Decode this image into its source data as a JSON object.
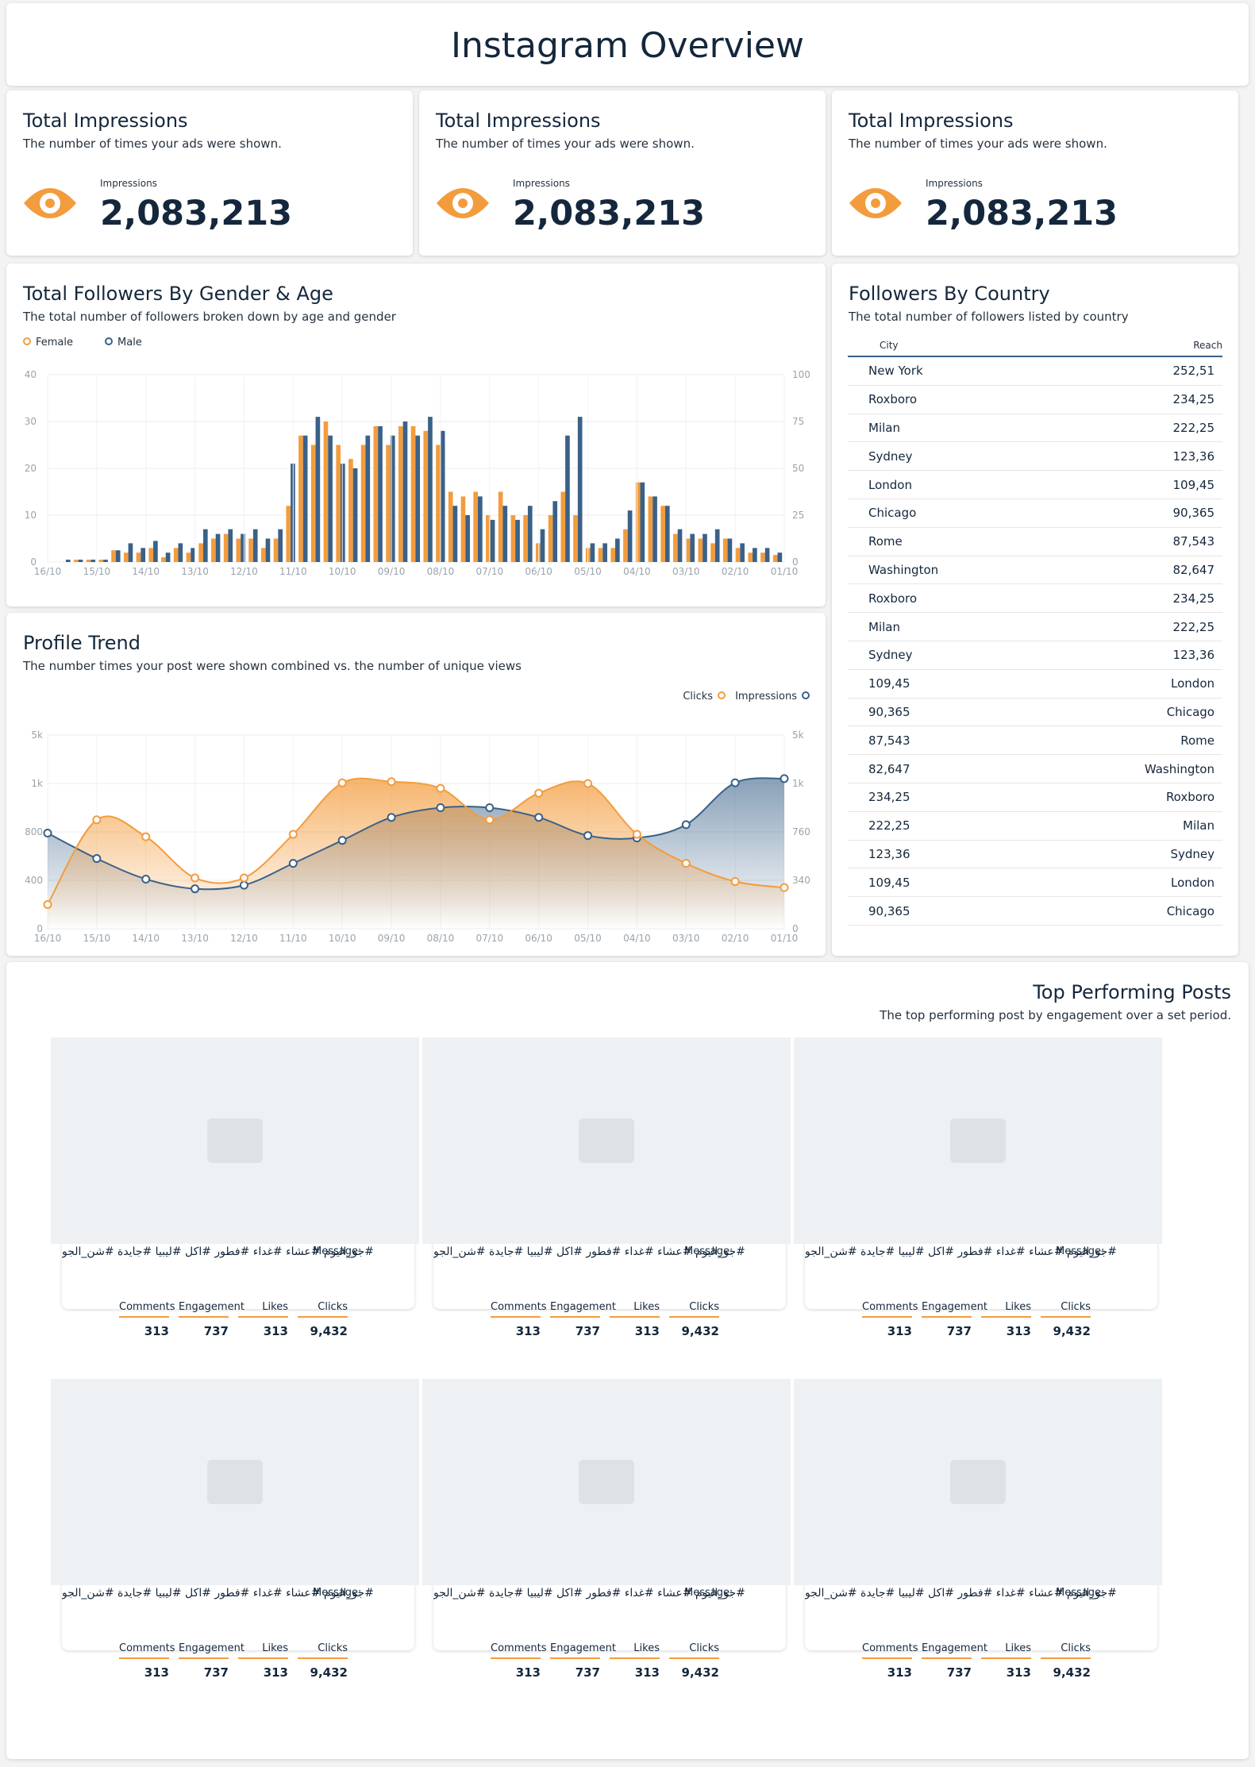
{
  "page": {
    "title": "Instagram Overview"
  },
  "kpis": [
    {
      "title": "Total Impressions",
      "subtitle": "The number of times your ads were shown.",
      "label": "Impressions",
      "value": "2,083,213",
      "icon": "eye-icon"
    },
    {
      "title": "Total Impressions",
      "subtitle": "The number of times your ads were shown.",
      "label": "Impressions",
      "value": "2,083,213",
      "icon": "eye-icon"
    },
    {
      "title": "Total Impressions",
      "subtitle": "The number of times your ads were shown.",
      "label": "Impressions",
      "value": "2,083,213",
      "icon": "eye-icon"
    }
  ],
  "gender_age": {
    "title": "Total Followers By Gender & Age",
    "subtitle": "The total number of followers broken down by age and gender",
    "legend": [
      "Female",
      "Male"
    ]
  },
  "profile_trend": {
    "title": "Profile Trend",
    "subtitle": "The number times your post were shown combined vs. the number of unique views",
    "legend": [
      "Clicks",
      "Impressions"
    ]
  },
  "country": {
    "title": "Followers By Country",
    "subtitle": "The total number of followers listed by country",
    "columns": [
      "City",
      "Reach"
    ],
    "rows": [
      [
        "New York",
        "252,51"
      ],
      [
        "Roxboro",
        "234,25"
      ],
      [
        "Milan",
        "222,25"
      ],
      [
        "Sydney",
        "123,36"
      ],
      [
        "London",
        "109,45"
      ],
      [
        "Chicago",
        "90,365"
      ],
      [
        "Rome",
        "87,543"
      ],
      [
        "Washington",
        "82,647"
      ],
      [
        "Roxboro",
        "234,25"
      ],
      [
        "Milan",
        "222,25"
      ],
      [
        "Sydney",
        "123,36"
      ],
      [
        "109,45",
        "London"
      ],
      [
        "90,365",
        "Chicago"
      ],
      [
        "87,543",
        "Rome"
      ],
      [
        "82,647",
        "Washington"
      ],
      [
        "234,25",
        "Roxboro"
      ],
      [
        "222,25",
        "Milan"
      ],
      [
        "123,36",
        "Sydney"
      ],
      [
        "109,45",
        "London"
      ],
      [
        "90,365",
        "Chicago"
      ]
    ]
  },
  "posts": {
    "title": "Top Performing Posts",
    "subtitle": "The top performing post by engagement over a set period.",
    "message_label": "Message:",
    "message_text": "#جو_اليوم #عشاء #غداء #فطور #اكل #ليبيا #جايدة #شن_الجو",
    "stat_labels": [
      "Comments",
      "Engagement",
      "Likes",
      "Clicks"
    ],
    "stat_values": [
      "313",
      "737",
      "313",
      "9,432"
    ]
  },
  "chart_data": [
    {
      "type": "bar",
      "categories": [
        "16/10",
        "15/10",
        "14/10",
        "13/10",
        "12/10",
        "11/10",
        "10/10",
        "09/10",
        "08/10",
        "07/10",
        "06/10",
        "05/10",
        "04/10",
        "03/10",
        "02/10",
        "01/10"
      ],
      "ylim": [
        0,
        40
      ],
      "y2lim": [
        0,
        100
      ],
      "yticks": [
        0,
        10,
        20,
        30,
        40
      ],
      "y2ticks": [
        0,
        25,
        50,
        75,
        100
      ],
      "series": [
        {
          "name": "Female",
          "values": [
            0,
            0,
            0.5,
            0.5,
            0.5,
            2.5,
            2,
            2,
            3,
            1,
            3,
            2,
            4,
            5,
            6,
            5,
            5,
            3,
            5,
            12,
            27,
            25,
            30,
            25,
            22,
            25,
            29,
            25,
            29,
            29,
            28,
            25,
            15,
            14,
            15,
            10,
            15,
            10,
            10,
            4,
            10,
            15,
            10,
            3,
            3,
            3,
            7,
            17,
            14,
            12,
            6,
            5,
            5,
            4,
            5,
            3,
            2,
            2,
            1.5
          ],
          "index_note": ""
        },
        {
          "name": "Male",
          "values": [
            0,
            0.5,
            0.5,
            0.5,
            0.5,
            2.5,
            4,
            3,
            4.5,
            2,
            4,
            3,
            7,
            6,
            7,
            6,
            7,
            5,
            7,
            21,
            27,
            31,
            27,
            21,
            20,
            27,
            29,
            27,
            30,
            27,
            31,
            28,
            12,
            10,
            14,
            9,
            12,
            9,
            12,
            7,
            13,
            27,
            31,
            4,
            4,
            5,
            11,
            17,
            14,
            12,
            7,
            6,
            6,
            7,
            5,
            4,
            3,
            3,
            2
          ]
        }
      ]
    },
    {
      "type": "line",
      "categories": [
        "16/10",
        "15/10",
        "14/10",
        "13/10",
        "12/10",
        "11/10",
        "10/10",
        "09/10",
        "08/10",
        "07/10",
        "06/10",
        "05/10",
        "04/10",
        "03/10",
        "02/10",
        "01/10"
      ],
      "yticks": [
        "0",
        "400",
        "800",
        "1k",
        "5k"
      ],
      "y2ticks": [
        "0",
        "340",
        "760",
        "1k",
        "5k"
      ],
      "series": [
        {
          "name": "Clicks",
          "values": [
            200,
            850,
            760,
            420,
            420,
            780,
            1050,
            1150,
            980,
            850,
            960,
            1000,
            780,
            540,
            390,
            340
          ]
        },
        {
          "name": "Impressions",
          "values": [
            790,
            580,
            410,
            330,
            360,
            540,
            730,
            860,
            900,
            900,
            860,
            770,
            750,
            830,
            1060,
            1400
          ]
        }
      ]
    }
  ]
}
